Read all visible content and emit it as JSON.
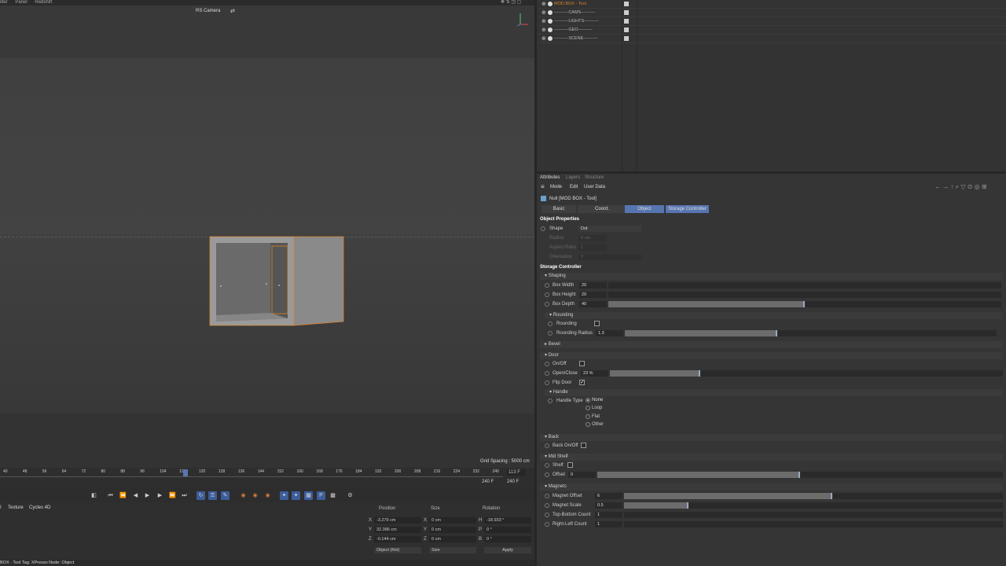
{
  "menubar": {
    "items": [
      "ilter",
      "Panel",
      "Redshift"
    ]
  },
  "viewport": {
    "camera_label": "RS Camera",
    "grid_spacing": "Grid Spacing : 5000 cm"
  },
  "timeline": {
    "ticks": [
      "40",
      "48",
      "56",
      "64",
      "72",
      "80",
      "88",
      "96",
      "104",
      "112",
      "120",
      "128",
      "136",
      "144",
      "152",
      "160",
      "168",
      "176",
      "184",
      "192",
      "200",
      "208",
      "216",
      "224",
      "232",
      "240"
    ],
    "current_frame": "113 F",
    "end_frame_a": "240 F",
    "end_frame_b": "240 F"
  },
  "bottom": {
    "tabs": [
      "I",
      "Texture",
      "Cycles 4D"
    ],
    "coord_headers": {
      "position": "Position",
      "size": "Size",
      "rotation": "Rotation"
    },
    "position": {
      "x": "-3.279 cm",
      "y": "32.386 cm",
      "z": "-0.144 cm"
    },
    "size": {
      "x": "0 cm",
      "y": "0 cm",
      "z": "0 cm"
    },
    "rotation": {
      "h": "-18.933 °",
      "p": "0 °",
      "b": "0 °"
    },
    "axis_labels": {
      "x": "X",
      "y": "Y",
      "z": "Z",
      "h": "H",
      "p": "P",
      "b": "B"
    },
    "mode_select": "Object (Rel)",
    "size_select": "Size",
    "apply_label": "Apply"
  },
  "status": {
    "text": "BOX - Tool  Tag: XPresso  Node: Object"
  },
  "objects": [
    {
      "name": "MOD BOX - Tool",
      "highlight": true
    },
    {
      "name": "----------CAMS----------",
      "highlight": false
    },
    {
      "name": "----------LIGHTS----------",
      "highlight": false
    },
    {
      "name": "----------GEO----------",
      "highlight": false
    },
    {
      "name": "----------SCENE----------",
      "highlight": false
    }
  ],
  "attributes": {
    "tabs": [
      "Attributes",
      "Layers",
      "Structure"
    ],
    "menu": [
      "Mode",
      "Edit",
      "User Data"
    ],
    "object_title": "Null [MOD BOX - Tool]",
    "subtabs": [
      "Basic",
      "Coord.",
      "Object",
      "Storage Controller"
    ],
    "object_properties": "Object Properties",
    "shape_label": "Shape",
    "shape_value": "Dot",
    "radius_label": "Radius",
    "radius_value": "0 cm",
    "aspect_label": "Aspect Ratio",
    "aspect_value": "1",
    "orientation_label": "Orientation",
    "orientation_value": "Y",
    "storage_controller": "Storage Controller",
    "shaping": "Shaping",
    "box_width_label": "Box Width",
    "box_width_value": "20",
    "box_height_label": "Box Height",
    "box_height_value": "20",
    "box_depth_label": "Box Depth",
    "box_depth_value": "40",
    "box_depth_fraction": 0.5,
    "rounding_group": "Rounding",
    "rounding_label": "Rounding",
    "rounding_radius_label": "Rounding Radius",
    "rounding_radius_value": "1.3",
    "rounding_radius_fraction": 0.41,
    "bevel": "Bevel",
    "door": "Door",
    "onoff_label": "On/Off",
    "openclose_label": "Open/Close",
    "openclose_value": "23 %",
    "openclose_fraction": 0.23,
    "flipdoor_label": "Flip Door",
    "handle": "Handle",
    "handle_type_label": "Handle Type",
    "handle_options": [
      "None",
      "Loop",
      "Flat",
      "Other"
    ],
    "back": "Back",
    "back_onoff_label": "Back On/Off",
    "midshelf": "Mid Shelf",
    "shelf_label": "Shelf",
    "offset_label": "Offset",
    "offset_value": "0",
    "offset_fraction": 0.5,
    "magnets": "Magnets",
    "magnet_offset_label": "Magnet Offset",
    "magnet_offset_value": "6",
    "magnet_offset_fraction": 0.55,
    "magnet_scale_label": "Magnet Scale",
    "magnet_scale_value": "0.5",
    "magnet_scale_fraction": 0.17,
    "top_bottom_label": "Top-Bottom Count",
    "top_bottom_value": "1",
    "right_left_label": "Right-Left Count",
    "right_left_value": "1"
  },
  "colors": {
    "accent": "#5775b0",
    "selection_orange": "#d9822b"
  }
}
